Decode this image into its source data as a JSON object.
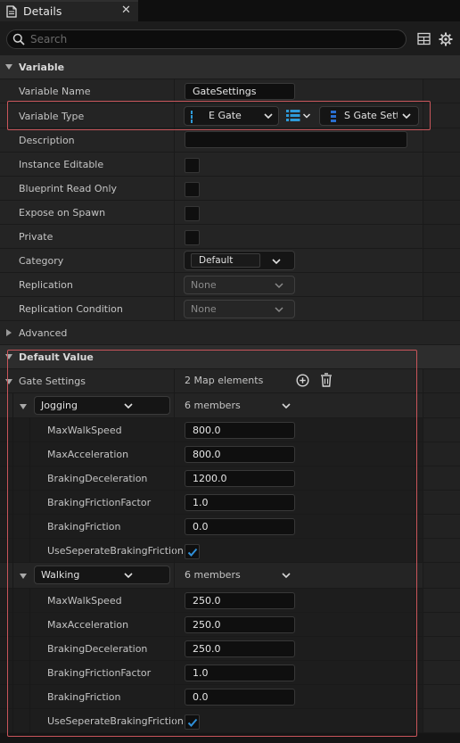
{
  "tab": {
    "title": "Details",
    "close_icon": "close-icon"
  },
  "search": {
    "placeholder": "Search",
    "value": ""
  },
  "sections": {
    "variable": "Variable",
    "default_value": "Default Value"
  },
  "variable": {
    "name_label": "Variable Name",
    "name_value": "GateSettings",
    "type_label": "Variable Type",
    "type_key": "E Gate",
    "type_value": "S Gate Sett",
    "description_label": "Description",
    "description_value": "",
    "instance_editable_label": "Instance Editable",
    "blueprint_readonly_label": "Blueprint Read Only",
    "expose_on_spawn_label": "Expose on Spawn",
    "private_label": "Private",
    "category_label": "Category",
    "category_value": "Default",
    "replication_label": "Replication",
    "replication_value": "None",
    "replication_condition_label": "Replication Condition",
    "replication_condition_value": "None",
    "advanced_label": "Advanced",
    "checkboxes": {
      "instance_editable": false,
      "blueprint_readonly": false,
      "expose_on_spawn": false,
      "private": false
    }
  },
  "default_value": {
    "gate_settings_label": "Gate Settings",
    "map_count": "2 Map elements",
    "entries": [
      {
        "key": "Jogging",
        "members": "6 members",
        "fields": [
          {
            "label": "MaxWalkSpeed",
            "value": "800.0"
          },
          {
            "label": "MaxAcceleration",
            "value": "800.0"
          },
          {
            "label": "BrakingDeceleration",
            "value": "1200.0"
          },
          {
            "label": "BrakingFrictionFactor",
            "value": "1.0"
          },
          {
            "label": "BrakingFriction",
            "value": "0.0"
          }
        ],
        "bool_label": "UseSeperateBrakingFriction",
        "bool_value": true
      },
      {
        "key": "Walking",
        "members": "6 members",
        "fields": [
          {
            "label": "MaxWalkSpeed",
            "value": "250.0"
          },
          {
            "label": "MaxAcceleration",
            "value": "250.0"
          },
          {
            "label": "BrakingDeceleration",
            "value": "250.0"
          },
          {
            "label": "BrakingFrictionFactor",
            "value": "1.0"
          },
          {
            "label": "BrakingFriction",
            "value": "0.0"
          }
        ],
        "bool_label": "UseSeperateBrakingFriction",
        "bool_value": true
      }
    ]
  },
  "colors": {
    "accent": "#2e9ad8",
    "highlight_box": "#c8555a",
    "checkbox_tick": "#2f8fd8"
  }
}
